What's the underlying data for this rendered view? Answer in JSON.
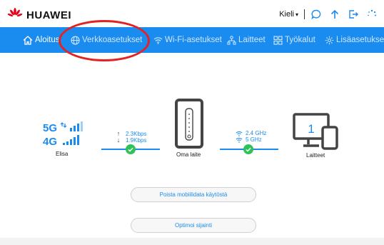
{
  "header": {
    "brand": "HUAWEI",
    "brand_color": "#e40019",
    "language_label": "Kieli",
    "icons": [
      "chat-icon",
      "upload-icon",
      "logout-icon",
      "loading-spinner-icon"
    ]
  },
  "nav": {
    "background": "#1a8cf0",
    "items": [
      {
        "label": "Aloitus",
        "icon": "home-icon"
      },
      {
        "label": "Verkkoasetukset",
        "icon": "globe-icon"
      },
      {
        "label": "Wi-Fi-asetukset",
        "icon": "wifi-icon"
      },
      {
        "label": "Laitteet",
        "icon": "devices-icon"
      },
      {
        "label": "Työkalut",
        "icon": "tools-icon"
      },
      {
        "label": "Lisäasetukset",
        "icon": "settings-gear-icon"
      }
    ],
    "highlight_color": "#e32222"
  },
  "status": {
    "network_types": [
      "5G",
      "4G"
    ],
    "operator": "Elisa",
    "upload_rate": "2.3Kbps",
    "download_rate": "1.9Kbps",
    "device_label": "Oma laite",
    "band_1": "2.4 GHz",
    "band_2": "5 GHz",
    "connected_devices_count": "1",
    "connected_devices_label": "Laitteet",
    "ok_color": "#2fc259"
  },
  "actions": {
    "disable_mobile_data": "Poista mobiilidata käytöstä",
    "optimize_location": "Optimoi sijainti"
  }
}
